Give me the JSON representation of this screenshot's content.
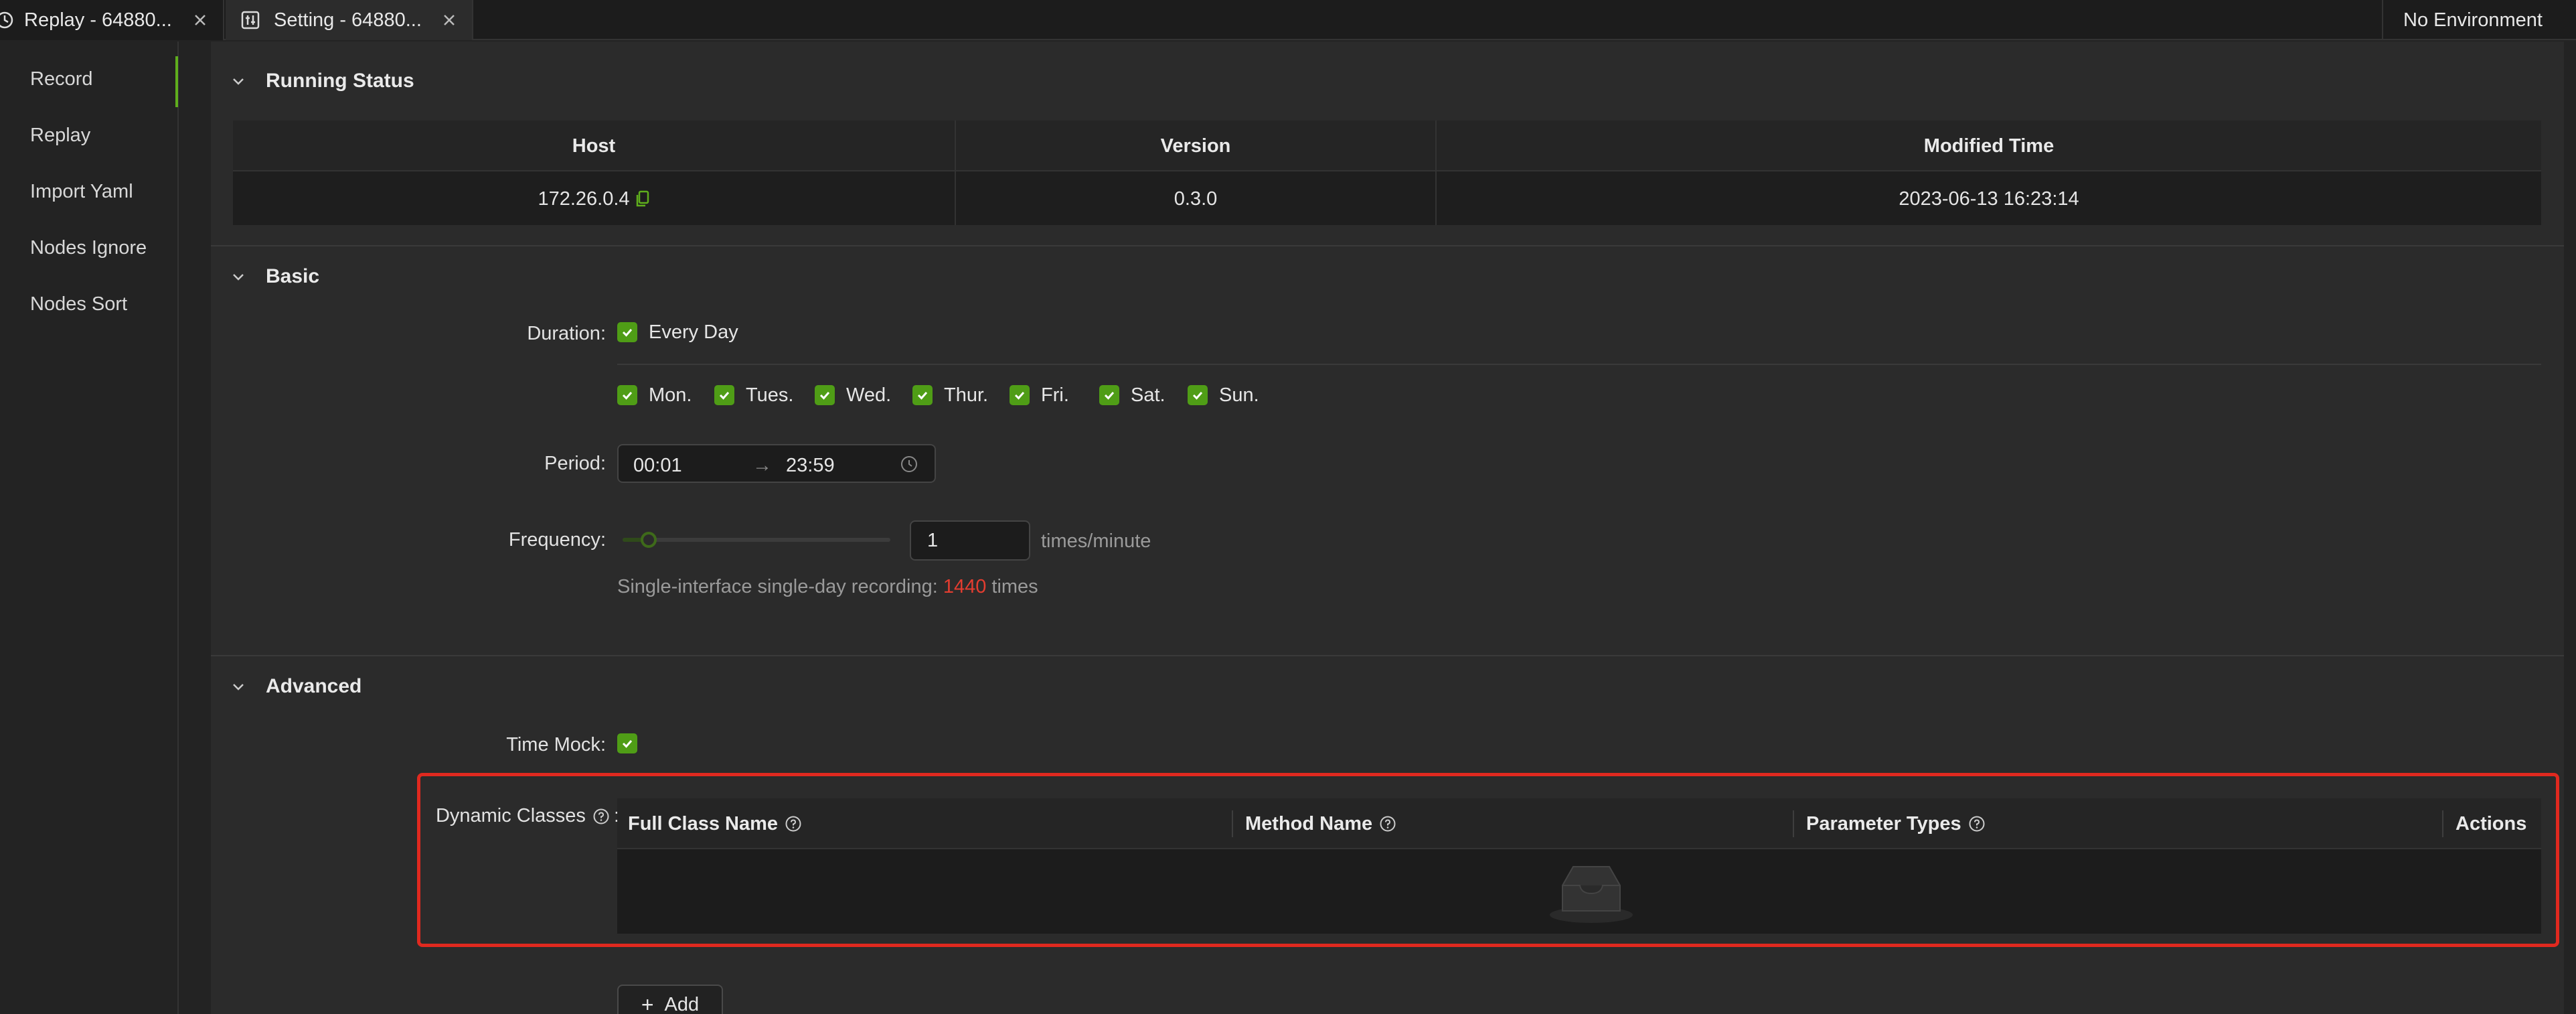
{
  "tabs": [
    {
      "label": "Replay - 64880...",
      "icon": "history-icon"
    },
    {
      "label": "Setting - 64880...",
      "icon": "settings-sliders-icon"
    }
  ],
  "environment": "No Environment",
  "sidebar": {
    "items": [
      {
        "label": "Record",
        "active": true
      },
      {
        "label": "Replay"
      },
      {
        "label": "Import Yaml"
      },
      {
        "label": "Nodes Ignore"
      },
      {
        "label": "Nodes Sort"
      }
    ]
  },
  "running_status": {
    "title": "Running Status",
    "columns": [
      "Host",
      "Version",
      "Modified Time"
    ],
    "row": {
      "host": "172.26.0.4",
      "version": "0.3.0",
      "modified": "2023-06-13 16:23:14"
    }
  },
  "basic": {
    "title": "Basic",
    "duration_label": "Duration",
    "every_day": "Every Day",
    "days": [
      "Mon.",
      "Tues.",
      "Wed.",
      "Thur.",
      "Fri.",
      "Sat.",
      "Sun."
    ],
    "period_label": "Period",
    "period_start": "00:01",
    "period_arrow": "→",
    "period_end": "23:59",
    "frequency_label": "Frequency",
    "frequency_value": "1",
    "frequency_unit": "times/minute",
    "recording_prefix": "Single-interface single-day recording: ",
    "recording_count": "1440",
    "recording_suffix": " times",
    "colon": ":"
  },
  "advanced": {
    "title": "Advanced",
    "time_mock_label": "Time Mock",
    "dynamic_classes_label": "Dynamic Classes",
    "columns": [
      "Full Class Name",
      "Method Name",
      "Parameter Types",
      "Actions"
    ],
    "add_label": "Add"
  },
  "colors": {
    "accent": "#4f9d16",
    "highlight": "#e0291f",
    "count": "#e43d30"
  }
}
